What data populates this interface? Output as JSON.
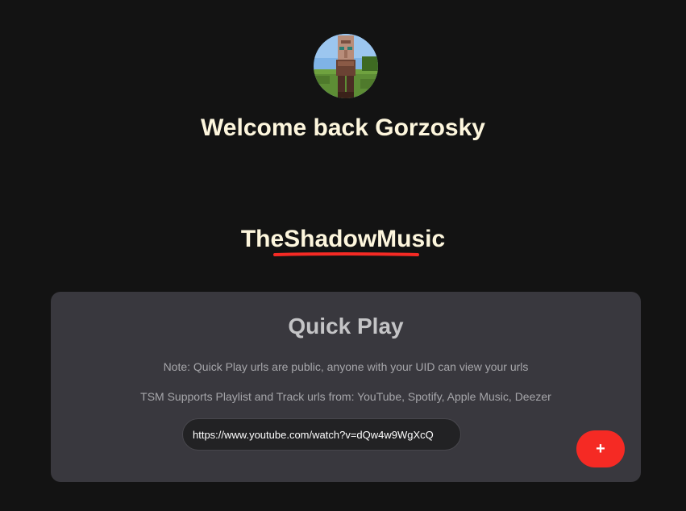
{
  "profile": {
    "avatar_icon": "minecraft-villager-avatar-icon",
    "welcome_text": "Welcome back Gorzosky"
  },
  "brand": {
    "name": "TheShadowMusic",
    "underline_color": "#f52a24"
  },
  "quick_play": {
    "title": "Quick Play",
    "note": "Note: Quick Play urls are public, anyone with your UID can view your urls",
    "supports": "TSM Supports Playlist and Track urls from: YouTube, Spotify, Apple Music, Deezer",
    "url_value": "https://www.youtube.com/watch?v=dQw4w9WgXcQ",
    "add_label": "+",
    "add_icon": "plus-icon"
  },
  "colors": {
    "background": "#131313",
    "card": "#39383e",
    "heading_text": "#fdf6dd",
    "accent": "#f52a24"
  }
}
